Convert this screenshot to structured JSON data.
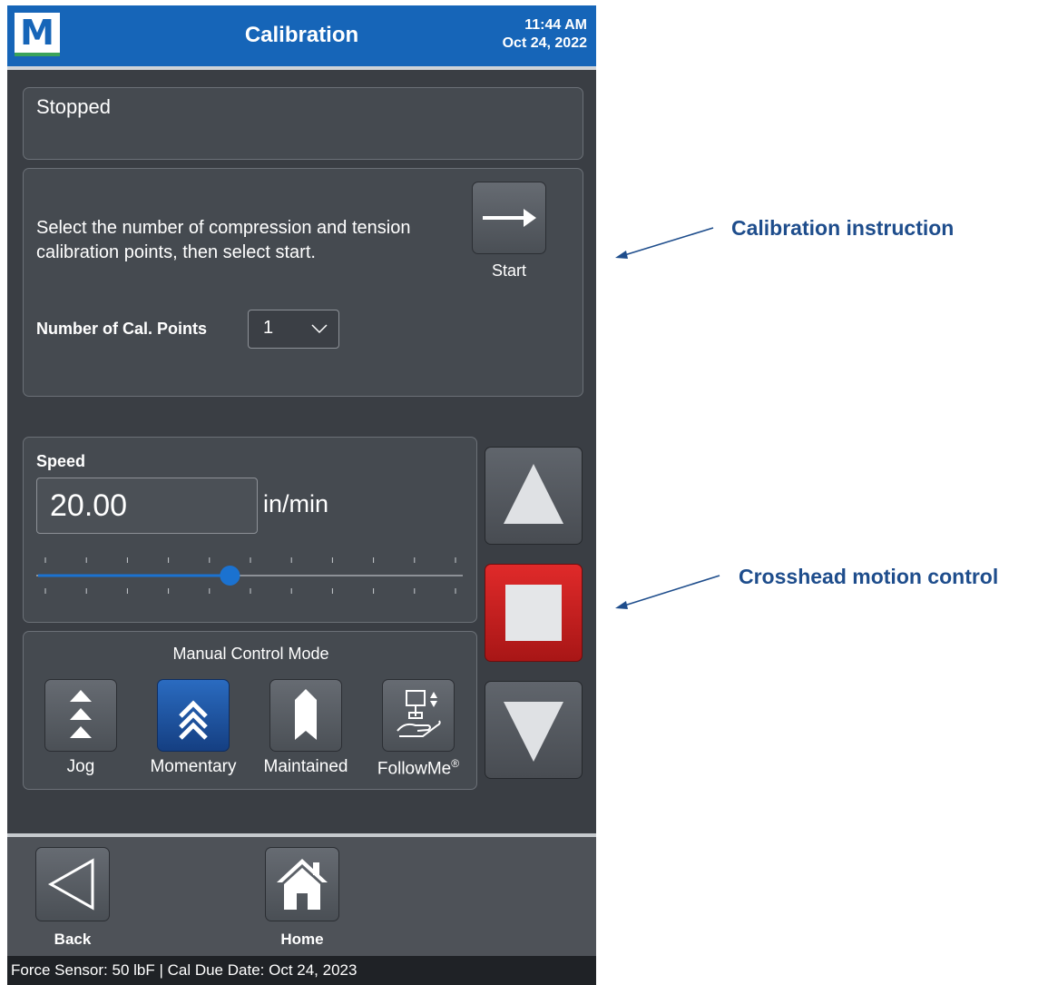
{
  "header": {
    "logo_letter": "M",
    "title": "Calibration",
    "time": "11:44 AM",
    "date": "Oct 24, 2022"
  },
  "status": {
    "text": "Stopped"
  },
  "calibration": {
    "instruction": "Select the number of compression and tension calibration points, then select start.",
    "start_label": "Start",
    "points_label": "Number of Cal. Points",
    "points_value": "1"
  },
  "speed": {
    "label": "Speed",
    "value": "20.00",
    "unit": "in/min",
    "slider_fraction": 0.45
  },
  "manual_mode": {
    "title": "Manual Control Mode",
    "modes": [
      {
        "label": "Jog",
        "icon": "jog-icon",
        "active": false
      },
      {
        "label": "Momentary",
        "icon": "momentary-icon",
        "active": true
      },
      {
        "label": "Maintained",
        "icon": "maintained-icon",
        "active": false
      },
      {
        "label": "FollowMe",
        "label_suffix": "®",
        "icon": "followme-icon",
        "active": false
      }
    ]
  },
  "motion": {
    "up_icon": "triangle-up-icon",
    "stop_icon": "stop-icon",
    "down_icon": "triangle-down-icon"
  },
  "footer": {
    "back_label": "Back",
    "home_label": "Home"
  },
  "statusbar": {
    "text": "Force Sensor: 50 lbF  |  Cal Due Date: Oct 24, 2023"
  },
  "annotations": {
    "instruction_label": "Calibration instruction",
    "motion_label": "Crosshead motion control"
  },
  "colors": {
    "brand_blue": "#1665b8",
    "stop_red": "#d42020",
    "active_mode": "#1d4f9c",
    "annotation": "#1e4d8c"
  }
}
